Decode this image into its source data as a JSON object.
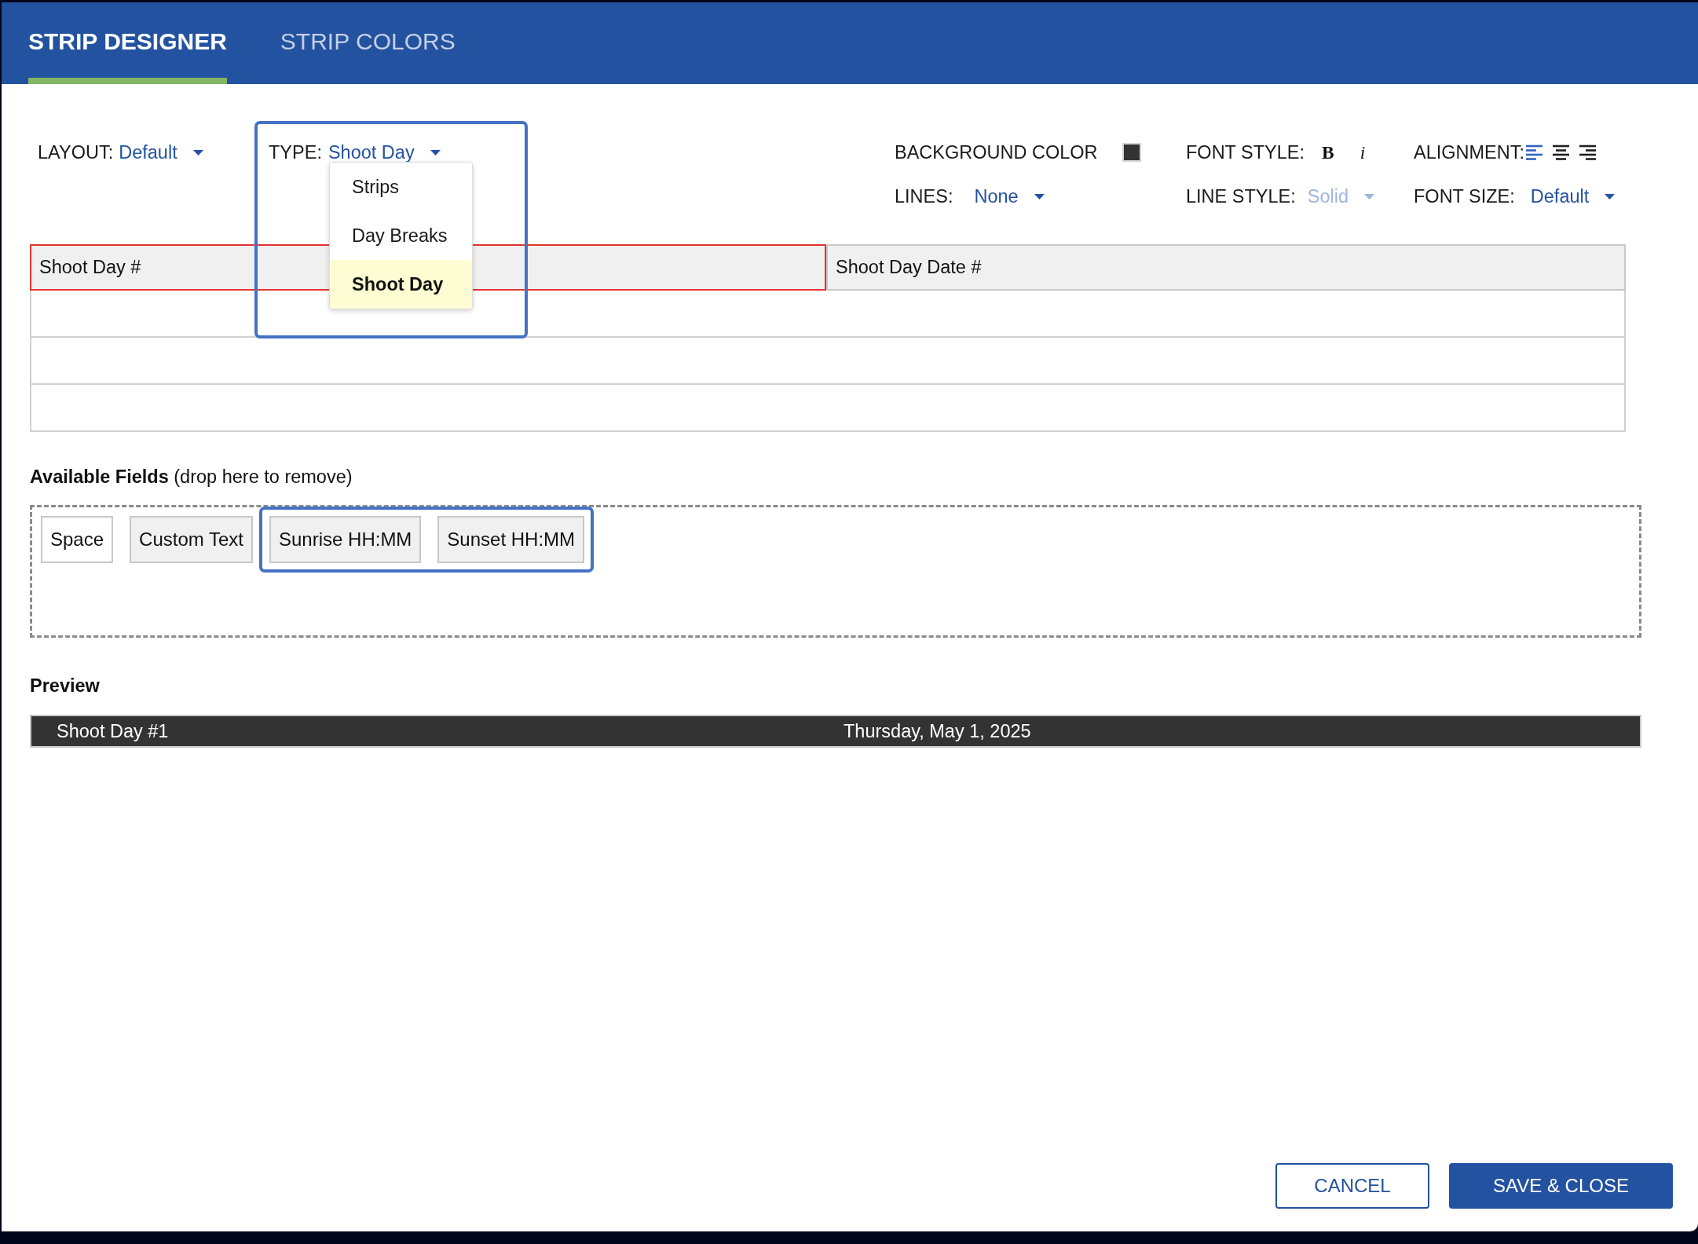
{
  "tabs": [
    {
      "label": "STRIP DESIGNER",
      "selected": true
    },
    {
      "label": "STRIP COLORS",
      "selected": false
    }
  ],
  "toolbar": {
    "layout": {
      "label": "LAYOUT:",
      "value": "Default",
      "disabled": false
    },
    "type": {
      "label": "TYPE:",
      "value": "Shoot Day",
      "disabled": false,
      "highlighted": true,
      "expanded": true,
      "options": [
        {
          "label": "Strips",
          "selected": false
        },
        {
          "label": "Day Breaks",
          "selected": false
        },
        {
          "label": "Shoot Day",
          "selected": true
        }
      ]
    },
    "background_color": {
      "label": "BACKGROUND COLOR",
      "color": "#333333"
    },
    "font_style": {
      "label": "FONT STYLE:",
      "options": [
        {
          "kind": "bold",
          "text": "B"
        },
        {
          "kind": "italic",
          "text": "i"
        }
      ]
    },
    "alignment": {
      "label": "ALIGNMENT:",
      "options": [
        {
          "kind": "left",
          "selected": true
        },
        {
          "kind": "center",
          "selected": false
        },
        {
          "kind": "right",
          "selected": false
        }
      ]
    },
    "lines": {
      "label": "LINES:",
      "value": "None",
      "disabled": false
    },
    "line_style": {
      "label": "LINE STYLE:",
      "value": "Solid",
      "disabled": true
    },
    "font_size": {
      "label": "FONT SIZE:",
      "value": "Default",
      "disabled": false
    }
  },
  "strip_layout": {
    "columns": [
      {
        "label": "Shoot Day #",
        "selected": true
      },
      {
        "label": "Shoot Day Date #",
        "selected": false
      }
    ]
  },
  "available_fields": {
    "title": "**Available Fields** (drop here to remove)",
    "items": [
      {
        "label": "Space",
        "kind": "blank",
        "highlighted": false
      },
      {
        "label": "Custom Text",
        "kind": "field",
        "highlighted": false
      },
      {
        "label": "Sunrise HH:MM",
        "kind": "field",
        "highlighted": true
      },
      {
        "label": "Sunset HH:MM",
        "kind": "field",
        "highlighted": true
      }
    ]
  },
  "preview": {
    "title": "Preview",
    "cells": [
      "Shoot Day #1",
      "Thursday, May 1, 2025"
    ]
  },
  "buttons": [
    {
      "label": "CANCEL",
      "kind": "secondary"
    },
    {
      "label": "SAVE & CLOSE",
      "kind": "primary"
    }
  ]
}
